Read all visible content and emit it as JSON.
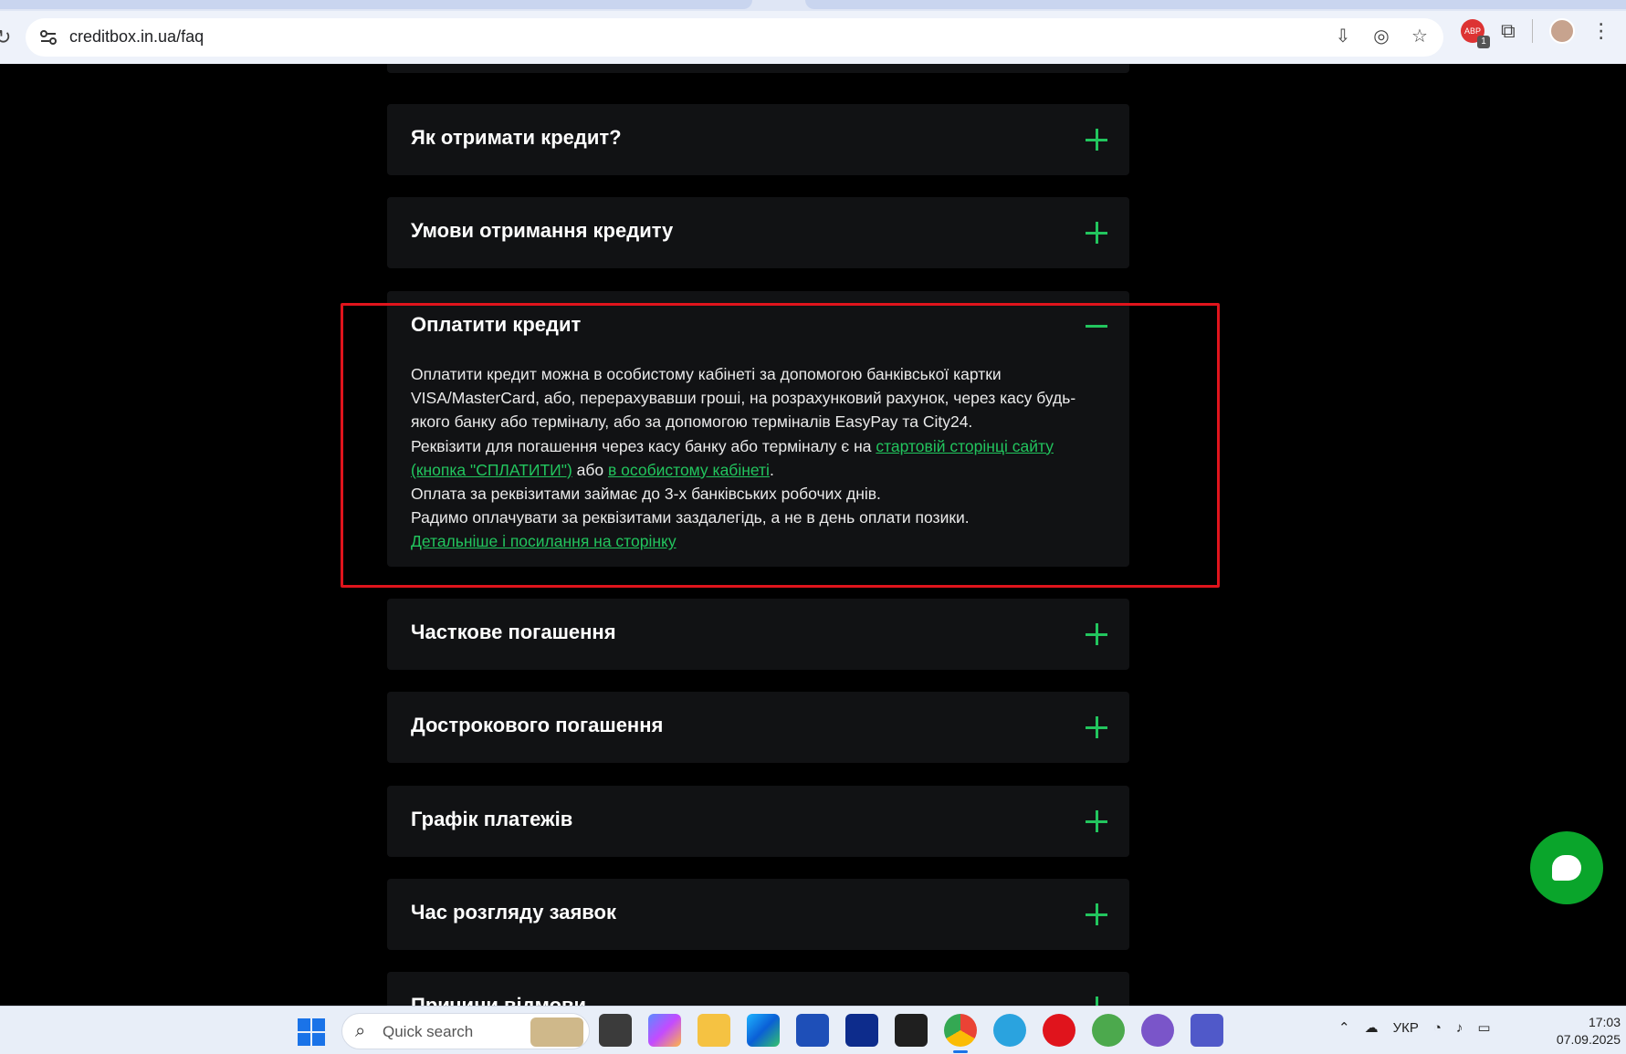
{
  "browser": {
    "url": "creditbox.in.ua/faq",
    "reload_fragment": "↻"
  },
  "faq": {
    "items": [
      {
        "question": "Як отримати кредит?"
      },
      {
        "question": "Умови отримання кредиту"
      },
      {
        "question": "Оплатити кредит",
        "expanded": true,
        "answer": {
          "p1": "Оплатити кредит можна в особистому кабінеті за допомогою банківської картки VISA/MasterCard, або, перерахувавши гроші, на розрахунковий рахунок, через касу будь-якого банку або терміналу, або за допомогою терміналів EasyPay та City24.",
          "p2_before": "Реквізити для погашення через касу банку або терміналу є на ",
          "p2_link1": "стартовій сторінці сайту (кнопка \"СПЛАТИТИ\")",
          "p2_mid": " або ",
          "p2_link2": "в особистому кабінеті",
          "p2_after": ".",
          "p3": "Оплата за реквізитами займає до 3-х банківських робочих днів.",
          "p4": "Радимо оплачувати за реквізитами заздалегідь, а не в день оплати позики.",
          "more_link": "Детальніше і посилання на сторінку"
        }
      },
      {
        "question": "Часткове погашення"
      },
      {
        "question": "Дострокового погашення"
      },
      {
        "question": "Графік платежів"
      },
      {
        "question": "Час розгляду заявок"
      },
      {
        "question": "Причини відмови"
      }
    ]
  },
  "taskbar": {
    "search_placeholder": "Quick search",
    "language": "УКР",
    "time": "17:03",
    "date": "07.09.2025"
  },
  "colors": {
    "accent_green": "#22c55e",
    "highlight_red": "#e0141c",
    "chat_green": "#0aa52b"
  }
}
